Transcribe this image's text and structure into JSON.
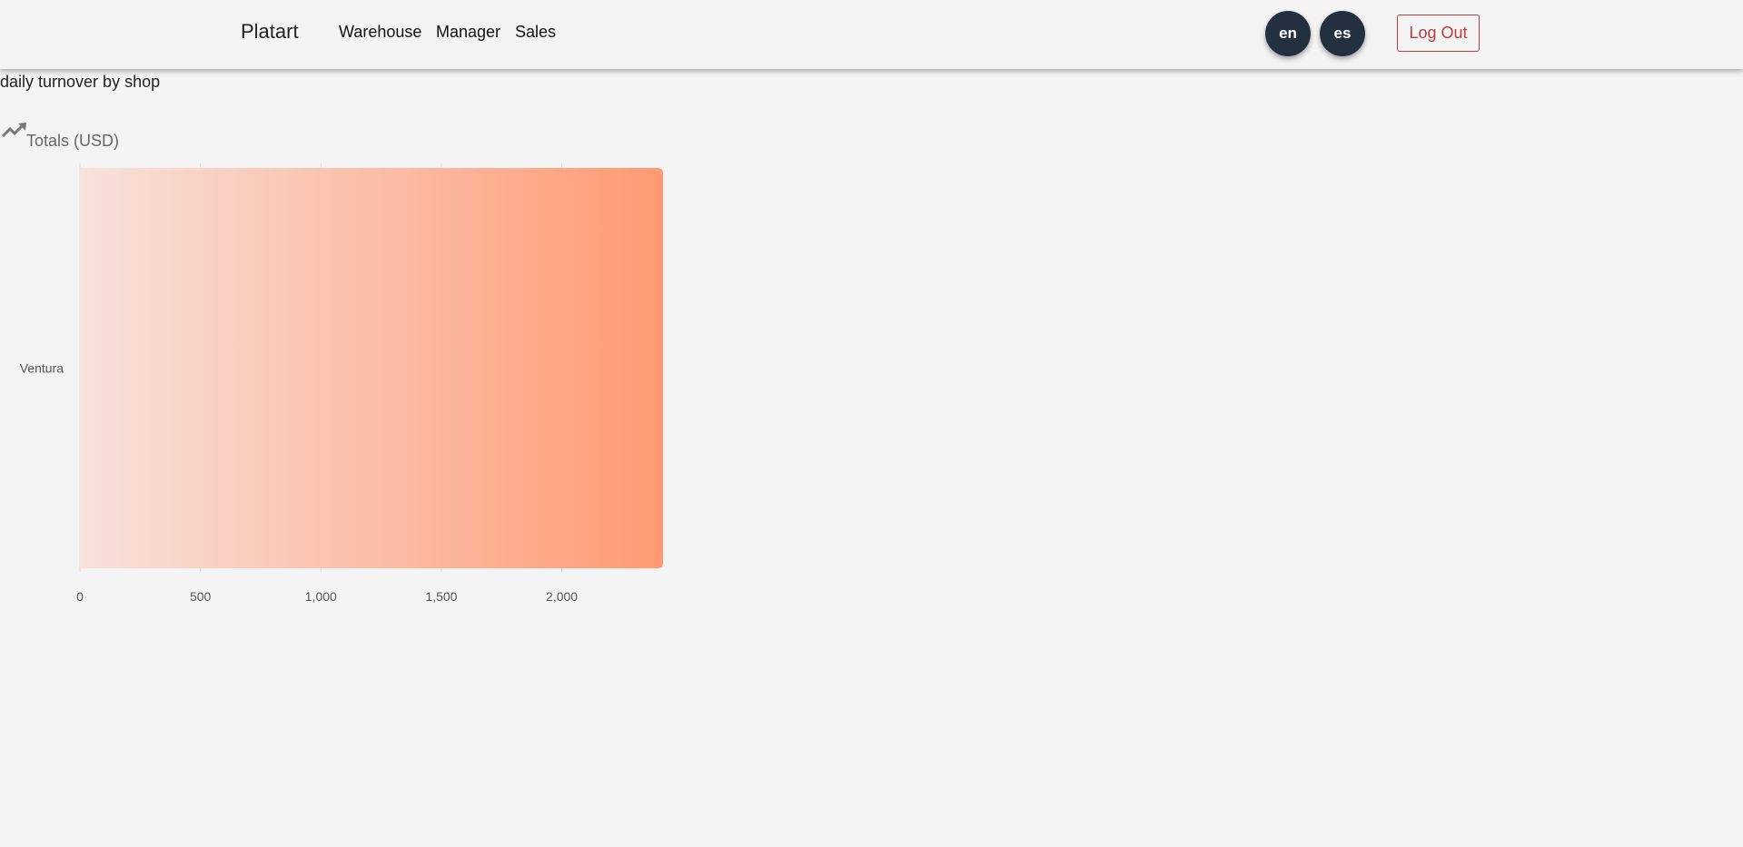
{
  "navbar": {
    "brand": "Platart",
    "links": [
      "Warehouse",
      "Manager",
      "Sales"
    ],
    "languages": [
      "en",
      "es"
    ],
    "logout_label": "Log Out"
  },
  "page": {
    "heading": "daily turnover by shop"
  },
  "card": {
    "icon": "trending-up-icon",
    "title": "Totals (USD)"
  },
  "colors": {
    "bar_start": "#f7e2dc",
    "bar_end": "#ff9a73",
    "language_button": "#23303f",
    "logout": "#c0393b"
  },
  "chart_data": {
    "type": "bar",
    "orientation": "horizontal",
    "categories": [
      "Ventura"
    ],
    "values": [
      2420
    ],
    "xlim": [
      0,
      2420
    ],
    "x_ticks": [
      0,
      500,
      1000,
      1500,
      2000
    ],
    "x_tick_labels": [
      "0",
      "500",
      "1,000",
      "1,500",
      "2,000"
    ],
    "grid": true
  }
}
